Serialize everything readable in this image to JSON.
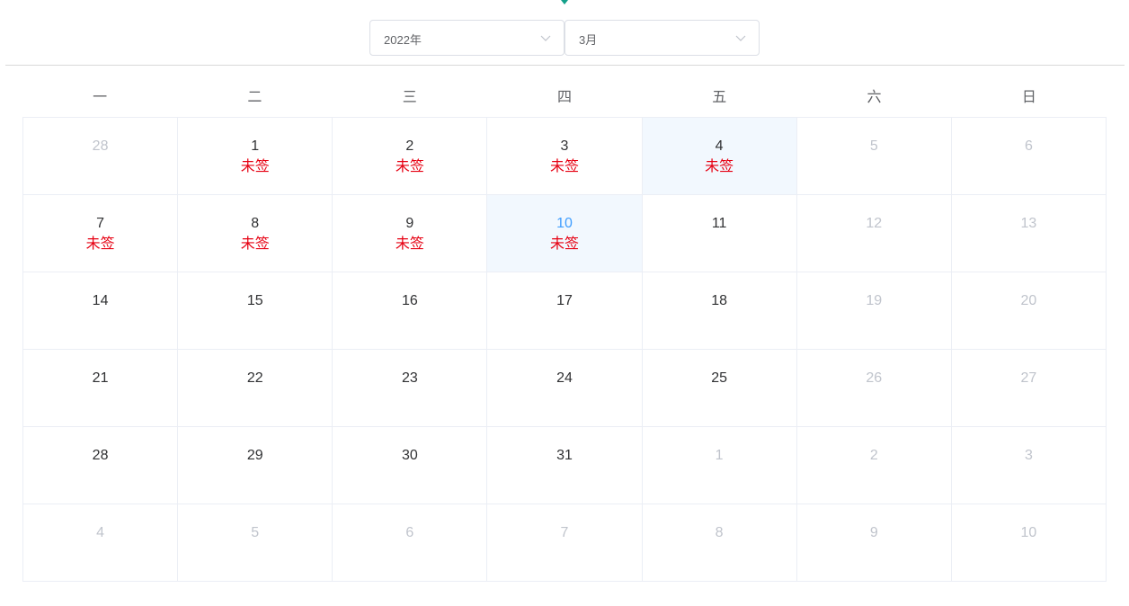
{
  "header": {
    "year_select": "2022年",
    "month_select": "3月"
  },
  "weekdays": [
    "一",
    "二",
    "三",
    "四",
    "五",
    "六",
    "日"
  ],
  "calendar": {
    "unsigned_label": "未签",
    "cells": [
      {
        "day": "28",
        "status": "other",
        "mark": ""
      },
      {
        "day": "1",
        "status": "current",
        "mark": "未签"
      },
      {
        "day": "2",
        "status": "current",
        "mark": "未签"
      },
      {
        "day": "3",
        "status": "current",
        "mark": "未签"
      },
      {
        "day": "4",
        "status": "selected",
        "mark": "未签"
      },
      {
        "day": "5",
        "status": "weekend",
        "mark": ""
      },
      {
        "day": "6",
        "status": "weekend",
        "mark": ""
      },
      {
        "day": "7",
        "status": "current",
        "mark": "未签"
      },
      {
        "day": "8",
        "status": "current",
        "mark": "未签"
      },
      {
        "day": "9",
        "status": "current",
        "mark": "未签"
      },
      {
        "day": "10",
        "status": "today",
        "mark": "未签"
      },
      {
        "day": "11",
        "status": "current",
        "mark": ""
      },
      {
        "day": "12",
        "status": "weekend",
        "mark": ""
      },
      {
        "day": "13",
        "status": "weekend",
        "mark": ""
      },
      {
        "day": "14",
        "status": "current",
        "mark": ""
      },
      {
        "day": "15",
        "status": "current",
        "mark": ""
      },
      {
        "day": "16",
        "status": "current",
        "mark": ""
      },
      {
        "day": "17",
        "status": "current",
        "mark": ""
      },
      {
        "day": "18",
        "status": "current",
        "mark": ""
      },
      {
        "day": "19",
        "status": "weekend",
        "mark": ""
      },
      {
        "day": "20",
        "status": "weekend",
        "mark": ""
      },
      {
        "day": "21",
        "status": "current",
        "mark": ""
      },
      {
        "day": "22",
        "status": "current",
        "mark": ""
      },
      {
        "day": "23",
        "status": "current",
        "mark": ""
      },
      {
        "day": "24",
        "status": "current",
        "mark": ""
      },
      {
        "day": "25",
        "status": "current",
        "mark": ""
      },
      {
        "day": "26",
        "status": "weekend",
        "mark": ""
      },
      {
        "day": "27",
        "status": "weekend",
        "mark": ""
      },
      {
        "day": "28",
        "status": "current",
        "mark": ""
      },
      {
        "day": "29",
        "status": "current",
        "mark": ""
      },
      {
        "day": "30",
        "status": "current",
        "mark": ""
      },
      {
        "day": "31",
        "status": "current",
        "mark": ""
      },
      {
        "day": "1",
        "status": "other",
        "mark": ""
      },
      {
        "day": "2",
        "status": "other",
        "mark": ""
      },
      {
        "day": "3",
        "status": "other",
        "mark": ""
      },
      {
        "day": "4",
        "status": "other",
        "mark": ""
      },
      {
        "day": "5",
        "status": "other",
        "mark": ""
      },
      {
        "day": "6",
        "status": "other",
        "mark": ""
      },
      {
        "day": "7",
        "status": "other",
        "mark": ""
      },
      {
        "day": "8",
        "status": "other",
        "mark": ""
      },
      {
        "day": "9",
        "status": "other",
        "mark": ""
      },
      {
        "day": "10",
        "status": "other",
        "mark": ""
      }
    ]
  },
  "colors": {
    "accent_marker": "#13a08a",
    "today_text": "#409eff",
    "selected_bg": "#f2f8fe",
    "unsigned_text": "#e60012",
    "muted_text": "#c0c4cc",
    "border": "#ebeef5"
  },
  "icons": {
    "top_marker": "caret-down-icon",
    "select_arrow": "chevron-down-icon"
  }
}
